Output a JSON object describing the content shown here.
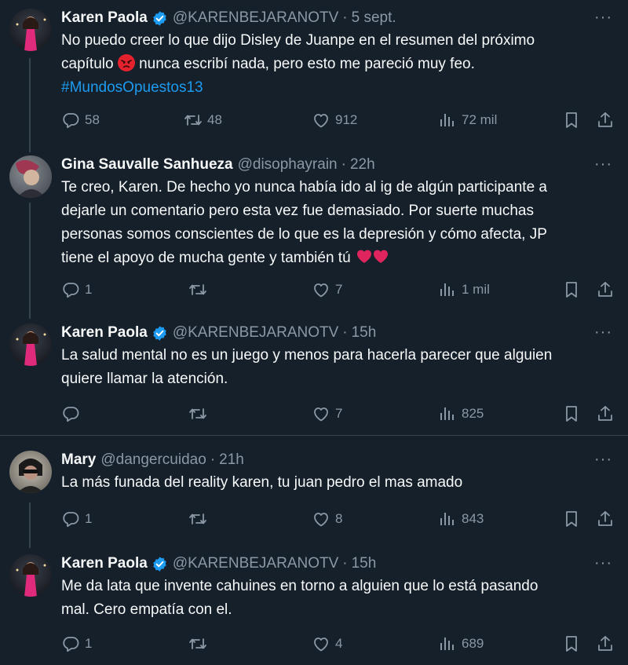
{
  "tweets": [
    {
      "name": "Karen Paola",
      "handle": "@KARENBEJARANOTV",
      "time": "5 sept.",
      "text_line1": "No puedo creer lo que dijo Disley de Juanpe en el resumen del próximo",
      "text_line2a": "capítulo",
      "text_line2b": "nunca escribí nada, pero esto me pareció muy feo.",
      "hashtag": "#MundosOpuestos13",
      "replies": "58",
      "retweets": "48",
      "likes": "912",
      "views": "72 mil"
    },
    {
      "name": "Gina Sauvalle Sanhueza",
      "handle": "@disophayrain",
      "time": "22h",
      "text_lines": [
        "Te creo, Karen. De hecho yo nunca había ido al ig de algún participante a",
        "dejarle un comentario pero esta vez fue demasiado. Por suerte muchas",
        "personas somos conscientes de lo que es la depresión y cómo afecta, JP",
        "tiene el apoyo de mucha gente y también tú"
      ],
      "replies": "1",
      "retweets": "",
      "likes": "7",
      "views": "1 mil"
    },
    {
      "name": "Karen Paola",
      "handle": "@KARENBEJARANOTV",
      "time": "15h",
      "text_lines": [
        "La salud mental no es un juego y menos para hacerla parecer que alguien",
        "quiere llamar la atención."
      ],
      "replies": "",
      "retweets": "",
      "likes": "7",
      "views": "825"
    },
    {
      "name": "Mary",
      "handle": "@dangercuidao",
      "time": "21h",
      "text_lines": [
        "La más funada del reality karen, tu juan pedro el mas amado"
      ],
      "replies": "1",
      "retweets": "",
      "likes": "8",
      "views": "843"
    },
    {
      "name": "Karen Paola",
      "handle": "@KARENBEJARANOTV",
      "time": "15h",
      "text_lines": [
        "Me da lata que invente cahuines en torno a alguien que lo está pasando",
        "mal. Cero empatía con el."
      ],
      "replies": "1",
      "retweets": "",
      "likes": "4",
      "views": "689"
    }
  ],
  "ui": {
    "more_label": "···",
    "separator": "·"
  },
  "colors": {
    "background": "#15202b",
    "text": "#f7f9f9",
    "secondary": "#8b98a5",
    "accent": "#1d9bf0",
    "divider": "#38444d"
  },
  "icons": {
    "reply": "reply-icon",
    "retweet": "retweet-icon",
    "like": "like-icon",
    "views": "views-icon",
    "bookmark": "bookmark-icon",
    "share": "share-icon",
    "verified": "verified-badge-icon",
    "more": "more-icon"
  }
}
